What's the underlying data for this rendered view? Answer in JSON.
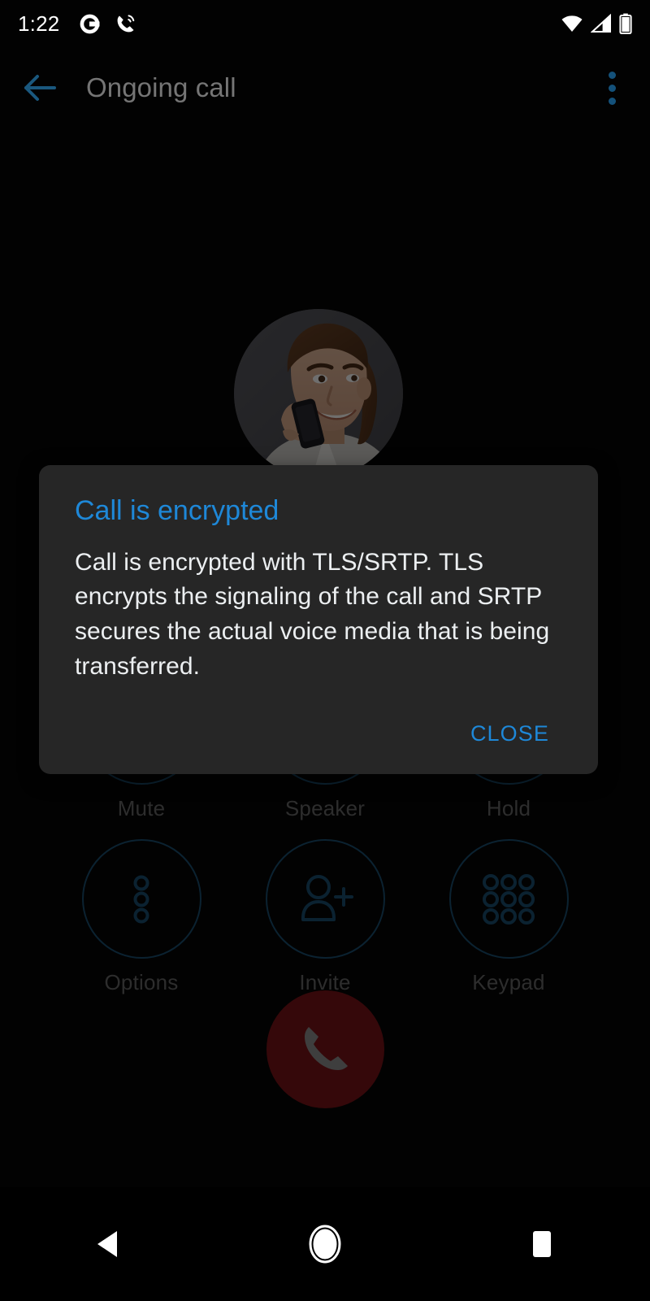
{
  "status_bar": {
    "time": "1:22",
    "left_icons": [
      "app-notification-icon",
      "ongoing-call-icon"
    ],
    "right_icons": [
      "wifi-icon",
      "cellular-signal-icon",
      "battery-icon"
    ]
  },
  "app_bar": {
    "back_label": "Back",
    "title": "Ongoing call",
    "overflow_label": "More options"
  },
  "call": {
    "avatar_alt": "Contact photo",
    "controls": [
      [
        {
          "label": "Mute",
          "icon": "microphone-off-icon"
        },
        {
          "label": "Speaker",
          "icon": "speaker-icon"
        },
        {
          "label": "Hold",
          "icon": "pause-icon"
        }
      ],
      [
        {
          "label": "Options",
          "icon": "more-vertical-icon"
        },
        {
          "label": "Invite",
          "icon": "person-add-icon"
        },
        {
          "label": "Keypad",
          "icon": "dialpad-icon"
        }
      ]
    ],
    "end_call_label": "End call"
  },
  "dialog": {
    "title": "Call is encrypted",
    "message": "Call is encrypted with TLS/SRTP. TLS encrypts the signaling of the call and SRTP secures the actual voice media that is being transferred.",
    "close_label": "CLOSE"
  },
  "nav_bar": {
    "back_label": "Back",
    "home_label": "Home",
    "recents_label": "Recent apps"
  },
  "colors": {
    "accent_blue": "#1e88d8",
    "dimmed_blue": "#1a4f70",
    "dialog_background": "#262626",
    "end_call_red": "#7a1418",
    "title_gray": "#757575",
    "label_gray": "#666666",
    "screen_background": "#050505"
  }
}
